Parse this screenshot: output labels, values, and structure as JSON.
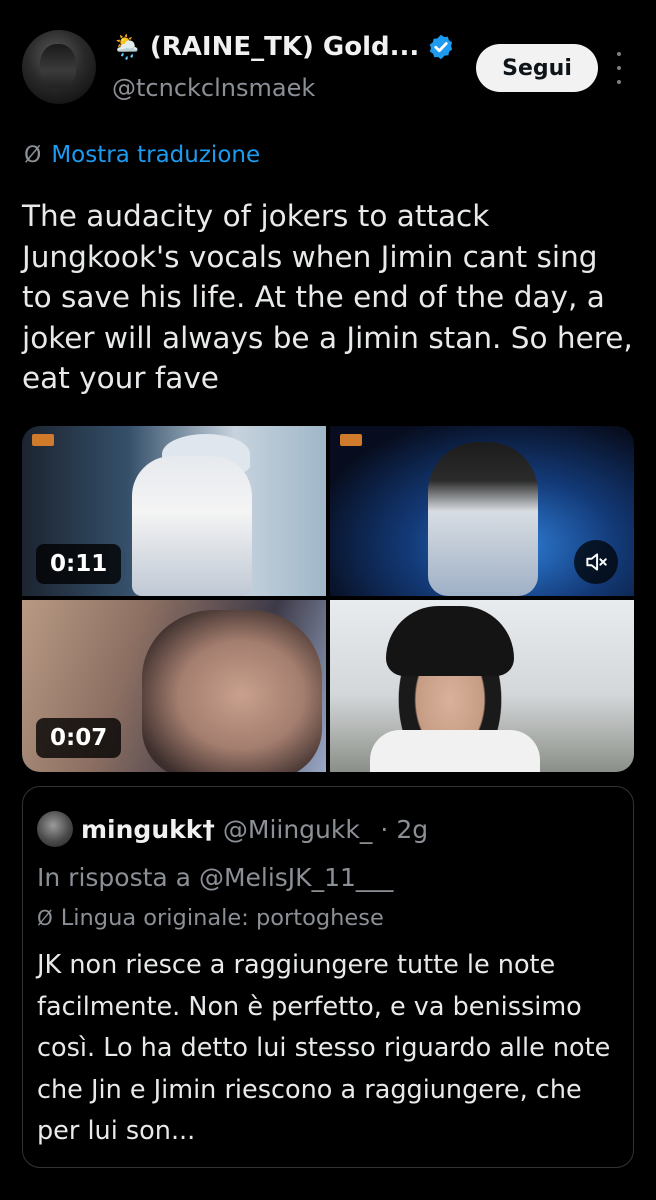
{
  "author": {
    "weather_emoji": "🌦️",
    "display_name": "(RAINE_TK) Gold...",
    "handle": "@tcnckclnsmaek",
    "follow_label": "Segui"
  },
  "translation": {
    "link_label": "Mostra traduzione"
  },
  "tweet": {
    "text": "The audacity of jokers to attack Jungkook's vocals when Jimin cant sing to save his life. At the end of the day, a joker will always be a Jimin stan. So here, eat your fave"
  },
  "media": [
    {
      "kind": "video",
      "duration": "0:11"
    },
    {
      "kind": "video",
      "muted": true
    },
    {
      "kind": "video",
      "duration": "0:07"
    },
    {
      "kind": "image"
    }
  ],
  "quote": {
    "name": "mingukk†",
    "handle": "@Miingukk_",
    "separator": "·",
    "time": "2g",
    "reply_to": "In risposta a @MelisJK_11___",
    "original_language": "Lingua originale: portoghese",
    "text": "JK non riesce a raggiungere tutte le note facilmente. Non è perfetto, e va benissimo così. Lo ha detto lui stesso riguardo alle note che Jin e Jimin riescono a raggiungere, che per lui son..."
  },
  "colors": {
    "link": "#1d9bf0",
    "verified": "#1d9bf0",
    "muted_text": "#8b9096"
  },
  "icons": [
    "weather-icon",
    "verified-icon",
    "more-icon",
    "translate-icon",
    "mute-icon"
  ]
}
